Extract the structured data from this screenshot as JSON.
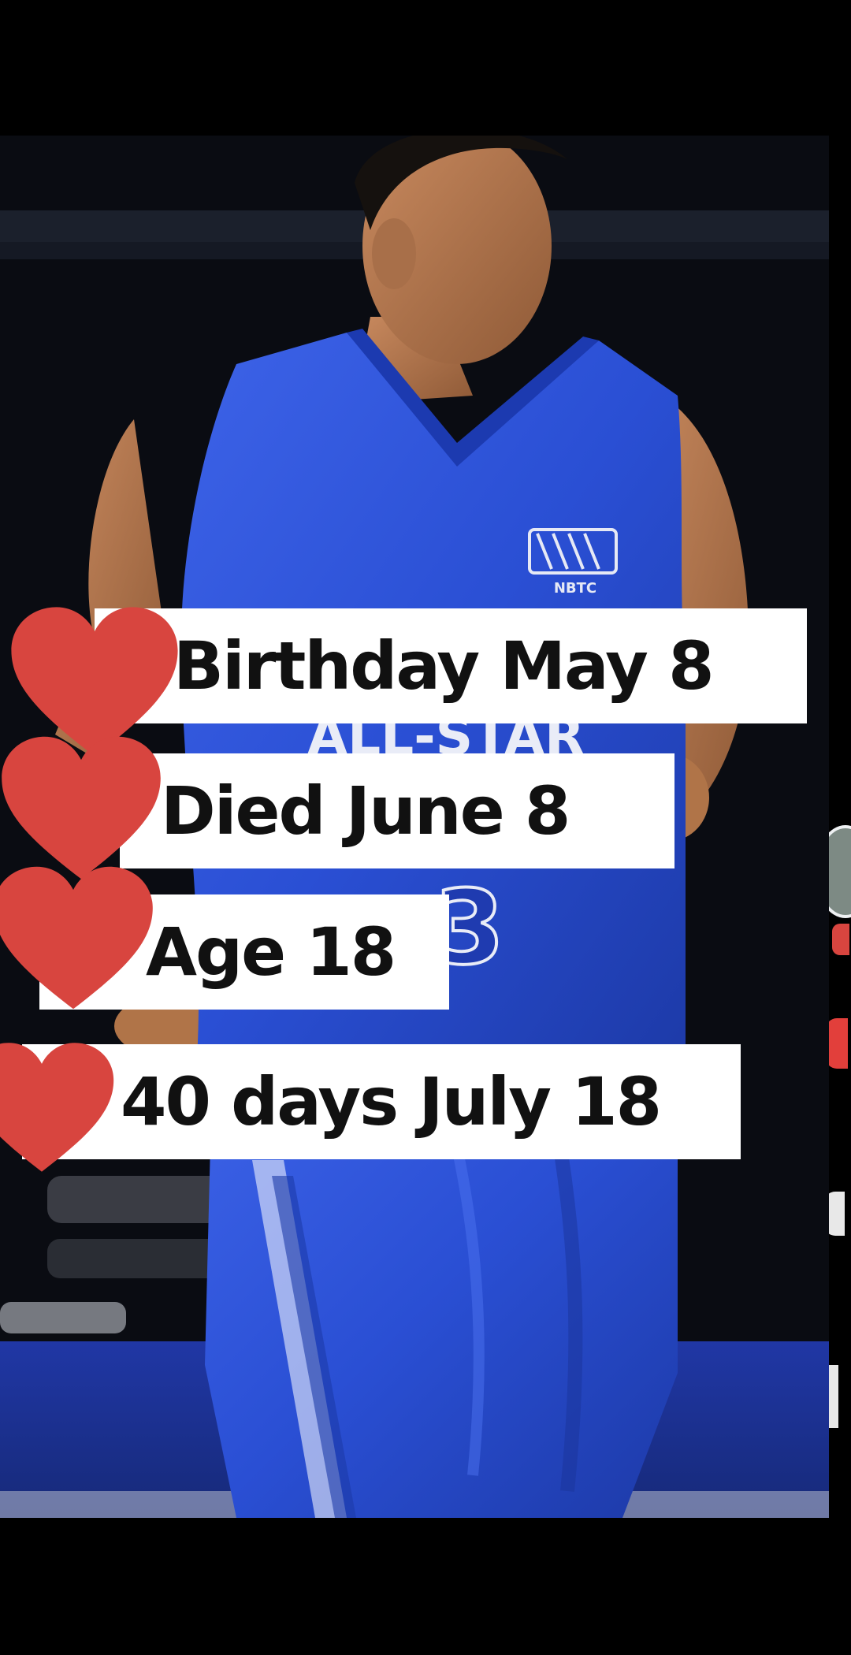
{
  "overlay": {
    "lines": [
      {
        "text": "Birthday May 8"
      },
      {
        "text": "Died June 8"
      },
      {
        "text": "Age 18"
      },
      {
        "text": "40 days July 18"
      }
    ]
  },
  "jersey": {
    "logo_text": "NBTC",
    "front_text": "ALL-STAR",
    "number": "3"
  },
  "colors": {
    "jersey_blue": "#2f54d6",
    "heart_red": "#d8453f",
    "label_bg": "#ffffff",
    "background": "#000000"
  },
  "icons": [
    "heart-icon",
    "avatar"
  ]
}
